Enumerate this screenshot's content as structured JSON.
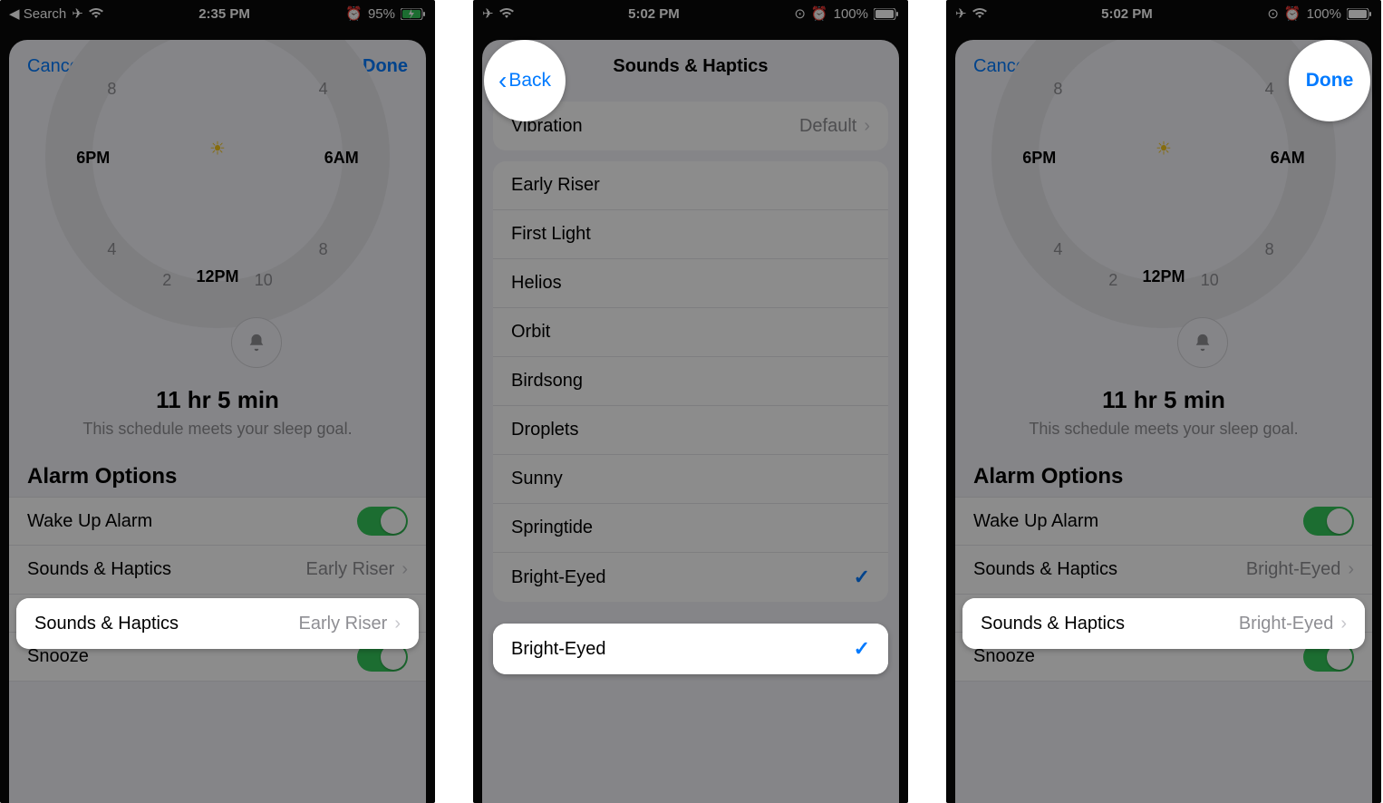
{
  "p1": {
    "status": {
      "back_app": "Search",
      "time": "2:35 PM",
      "battery": "95%"
    },
    "nav": {
      "cancel": "Cancel",
      "done": "Done"
    },
    "dial": {
      "h12": "12PM",
      "h6p": "6PM",
      "h6a": "6AM",
      "n2": "2",
      "n4": "4",
      "n8": "8",
      "n10": "10",
      "n4b": "4",
      "n8b": "8"
    },
    "duration": "11 hr 5 min",
    "goal": "This schedule meets your sleep goal.",
    "section": "Alarm Options",
    "rows": {
      "wake": "Wake Up Alarm",
      "sounds": "Sounds & Haptics",
      "sounds_value": "Early Riser",
      "snooze": "Snooze"
    }
  },
  "p2": {
    "status": {
      "time": "5:02 PM",
      "battery": "100%"
    },
    "nav": {
      "back": "Back",
      "title": "Sounds & Haptics"
    },
    "vibration": {
      "label": "Vibration",
      "value": "Default"
    },
    "sounds": [
      "Early Riser",
      "First Light",
      "Helios",
      "Orbit",
      "Birdsong",
      "Droplets",
      "Sunny",
      "Springtide",
      "Bright-Eyed"
    ]
  },
  "p3": {
    "status": {
      "time": "5:02 PM",
      "battery": "100%"
    },
    "nav": {
      "cancel": "Cancel",
      "done": "Done"
    },
    "dial": {
      "h12": "12PM",
      "h6p": "6PM",
      "h6a": "6AM",
      "n2": "2",
      "n4": "4",
      "n8": "8",
      "n10": "10",
      "n4b": "4",
      "n8b": "8"
    },
    "duration": "11 hr 5 min",
    "goal": "This schedule meets your sleep goal.",
    "section": "Alarm Options",
    "rows": {
      "wake": "Wake Up Alarm",
      "sounds": "Sounds & Haptics",
      "sounds_value": "Bright-Eyed",
      "snooze": "Snooze"
    }
  }
}
